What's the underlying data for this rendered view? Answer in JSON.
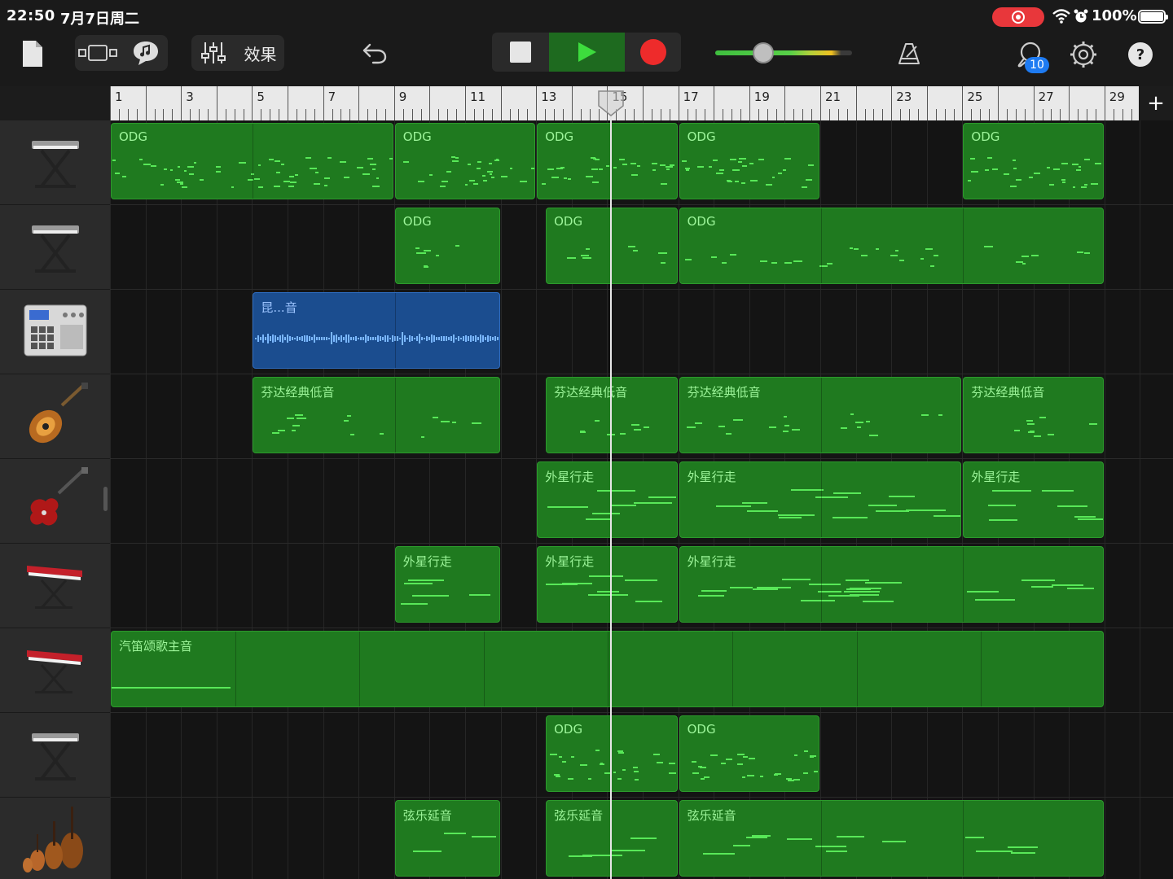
{
  "status_bar": {
    "time": "22:50",
    "date": "7月7日周二",
    "battery_percent": "100%",
    "icons": [
      "screen-record-icon",
      "wifi-icon",
      "alarm-icon",
      "battery-icon"
    ]
  },
  "toolbar": {
    "effects_label": "效果",
    "loops_badge": "10",
    "volume_level": 0.35,
    "accent_play": "#1e6a1f",
    "record_color": "#ee2b2b",
    "icons": [
      "document-icon",
      "track-view-icon",
      "smart-controls-icon",
      "mixer-icon",
      "undo-icon",
      "stop-icon",
      "play-icon",
      "record-icon",
      "metronome-icon",
      "loop-browser-icon",
      "settings-icon",
      "help-icon"
    ]
  },
  "ruler": {
    "bar_labels": [
      "1",
      "3",
      "5",
      "7",
      "9",
      "11",
      "13",
      "15",
      "17",
      "19",
      "21",
      "23",
      "25",
      "27",
      "29"
    ],
    "playhead_bar": "15"
  },
  "tracks": [
    {
      "instrument": "keyboard-stand-icon",
      "regions": [
        {
          "name": "ODG",
          "start": 1,
          "end": 9,
          "kind": "midi-dense"
        },
        {
          "name": "ODG",
          "start": 9,
          "end": 13,
          "kind": "midi-dense"
        },
        {
          "name": "ODG",
          "start": 13,
          "end": 17,
          "kind": "midi-dense"
        },
        {
          "name": "ODG",
          "start": 17,
          "end": 21,
          "kind": "midi-dense"
        },
        {
          "name": "ODG",
          "start": 25,
          "end": 29,
          "kind": "midi-dense"
        }
      ]
    },
    {
      "instrument": "keyboard-stand-icon",
      "regions": [
        {
          "name": "ODG",
          "start": 9,
          "end": 12,
          "kind": "midi-sparse"
        },
        {
          "name": "ODG",
          "start": 13.25,
          "end": 17,
          "kind": "midi-sparse"
        },
        {
          "name": "ODG",
          "start": 17,
          "end": 29,
          "kind": "midi-sparse"
        }
      ]
    },
    {
      "instrument": "drum-machine-icon",
      "regions": [
        {
          "name": "昆...音",
          "start": 5,
          "end": 12,
          "kind": "audio"
        }
      ]
    },
    {
      "instrument": "bass-guitar-icon",
      "regions": [
        {
          "name": "芬达经典低音",
          "start": 5,
          "end": 12,
          "kind": "midi-sparse"
        },
        {
          "name": "芬达经典低音",
          "start": 13.25,
          "end": 17,
          "kind": "midi-sparse"
        },
        {
          "name": "芬达经典低音",
          "start": 17,
          "end": 25,
          "kind": "midi-sparse"
        },
        {
          "name": "芬达经典低音",
          "start": 25,
          "end": 29,
          "kind": "midi-sparse"
        }
      ]
    },
    {
      "instrument": "electric-guitar-icon",
      "regions": [
        {
          "name": "外星行走",
          "start": 13,
          "end": 17,
          "kind": "midi-lines"
        },
        {
          "name": "外星行走",
          "start": 17,
          "end": 25,
          "kind": "midi-lines"
        },
        {
          "name": "外星行走",
          "start": 25,
          "end": 29,
          "kind": "midi-lines"
        }
      ]
    },
    {
      "instrument": "red-synth-icon",
      "regions": [
        {
          "name": "外星行走",
          "start": 9,
          "end": 12,
          "kind": "midi-lines"
        },
        {
          "name": "外星行走",
          "start": 13,
          "end": 17,
          "kind": "midi-lines"
        },
        {
          "name": "外星行走",
          "start": 17,
          "end": 29,
          "kind": "midi-lines"
        }
      ]
    },
    {
      "instrument": "red-synth-icon",
      "regions": [
        {
          "name": "汽笛颂歌主音",
          "start": 1,
          "end": 29,
          "kind": "midi-flat"
        }
      ]
    },
    {
      "instrument": "keyboard-stand-icon",
      "regions": [
        {
          "name": "ODG",
          "start": 13.25,
          "end": 17,
          "kind": "midi-dense"
        },
        {
          "name": "ODG",
          "start": 17,
          "end": 21,
          "kind": "midi-dense"
        }
      ]
    },
    {
      "instrument": "string-section-icon",
      "regions": [
        {
          "name": "弦乐延音",
          "start": 9,
          "end": 12,
          "kind": "midi-strings"
        },
        {
          "name": "弦乐延音",
          "start": 13.25,
          "end": 17,
          "kind": "midi-strings"
        },
        {
          "name": "弦乐延音",
          "start": 17,
          "end": 29,
          "kind": "midi-strings"
        }
      ]
    }
  ]
}
